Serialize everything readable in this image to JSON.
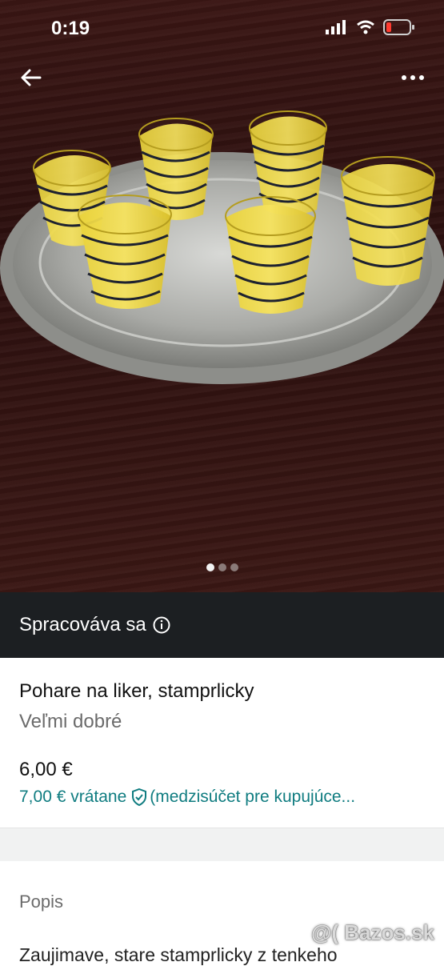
{
  "status_bar": {
    "time": "0:19"
  },
  "gallery": {
    "image_alt": "Yellow striped shot glasses on silver tray",
    "dots": 3,
    "active_index": 0
  },
  "banner": {
    "text": "Spracováva sa"
  },
  "item": {
    "title": "Pohare na liker, stamprlicky",
    "condition": "Veľmi dobré",
    "price": "6,00 €",
    "price_with_fee": "7,00 € vrátane",
    "fee_note": "(medzisúčet pre kupujúce..."
  },
  "description": {
    "heading": "Popis",
    "text_preview": "Zaujimave, stare stamprlicky z tenkeho"
  },
  "watermark": "@( Bazos.sk",
  "colors": {
    "banner_bg": "#1c1f22",
    "link_teal": "#0f7c80"
  }
}
